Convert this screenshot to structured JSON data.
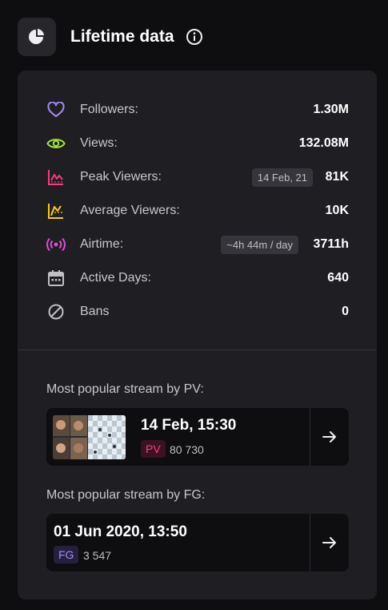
{
  "header": {
    "title": "Lifetime data",
    "icon": "pie-chart-icon",
    "info_icon": "info-icon"
  },
  "stats": [
    {
      "icon": "heart-icon",
      "label": "Followers:",
      "value": "1.30M",
      "badge": "",
      "color": "#a78bfa"
    },
    {
      "icon": "eye-icon",
      "label": "Views:",
      "value": "132.08M",
      "badge": "",
      "color": "#a3e635"
    },
    {
      "icon": "peak-chart-icon",
      "label": "Peak Viewers:",
      "value": "81K",
      "badge": "14 Feb, 21",
      "color": "#fb3a7c"
    },
    {
      "icon": "average-chart-icon",
      "label": "Average Viewers:",
      "value": "10K",
      "badge": "",
      "color": "#facc15"
    },
    {
      "icon": "broadcast-icon",
      "label": "Airtime:",
      "value": "3711h",
      "badge": "~4h 44m / day",
      "color": "#e649d6"
    },
    {
      "icon": "calendar-icon",
      "label": "Active Days:",
      "value": "640",
      "badge": "",
      "color": "#bfbfc4"
    },
    {
      "icon": "ban-icon",
      "label": "Bans",
      "value": "0",
      "badge": "",
      "color": "#bfbfc4"
    }
  ],
  "popular_pv": {
    "title": "Most popular stream by PV:",
    "date": "14 Feb, 15:30",
    "tag": "PV",
    "count": "80 730"
  },
  "popular_fg": {
    "title": "Most popular stream by FG:",
    "date": "01 Jun 2020, 13:50",
    "tag": "FG",
    "count": "3 547"
  }
}
